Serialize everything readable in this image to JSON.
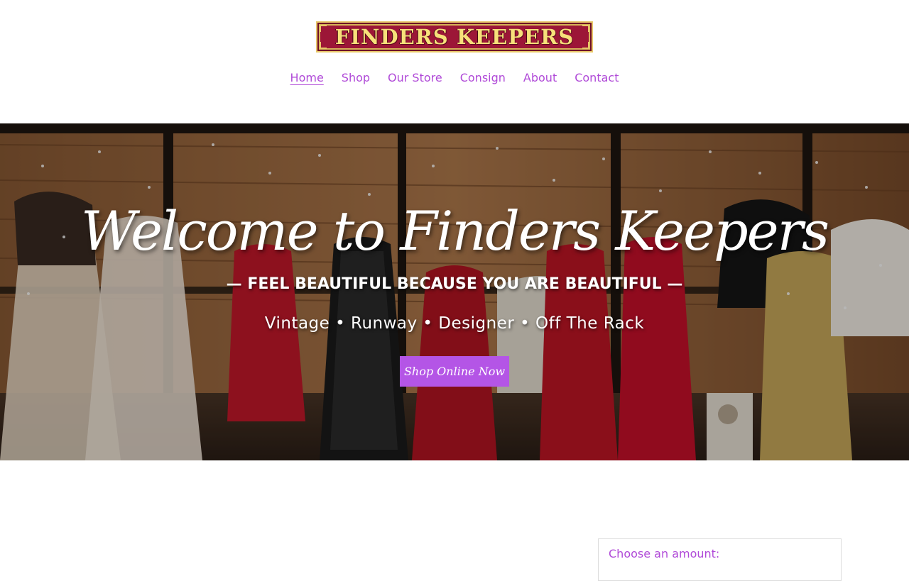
{
  "brand": {
    "logo_text": "FINDERS KEEPERS",
    "logo_bg": "#9c1637",
    "logo_fg": "#f7e07a"
  },
  "nav": {
    "items": [
      {
        "label": "Home",
        "active": true
      },
      {
        "label": "Shop",
        "active": false
      },
      {
        "label": "Our Store",
        "active": false
      },
      {
        "label": "Consign",
        "active": false
      },
      {
        "label": "About",
        "active": false
      },
      {
        "label": "Contact",
        "active": false
      }
    ],
    "color": "#b04ad8"
  },
  "hero": {
    "title": "Welcome to Finders Keepers",
    "tagline": "— FEEL BEAUTIFUL BECAUSE YOU ARE BEAUTIFUL —",
    "subtitle": "Vintage • Runway • Designer • Off The Rack",
    "button_label": "Shop Online Now",
    "button_color": "#b455e6"
  },
  "donation": {
    "label": "Choose an amount:"
  }
}
